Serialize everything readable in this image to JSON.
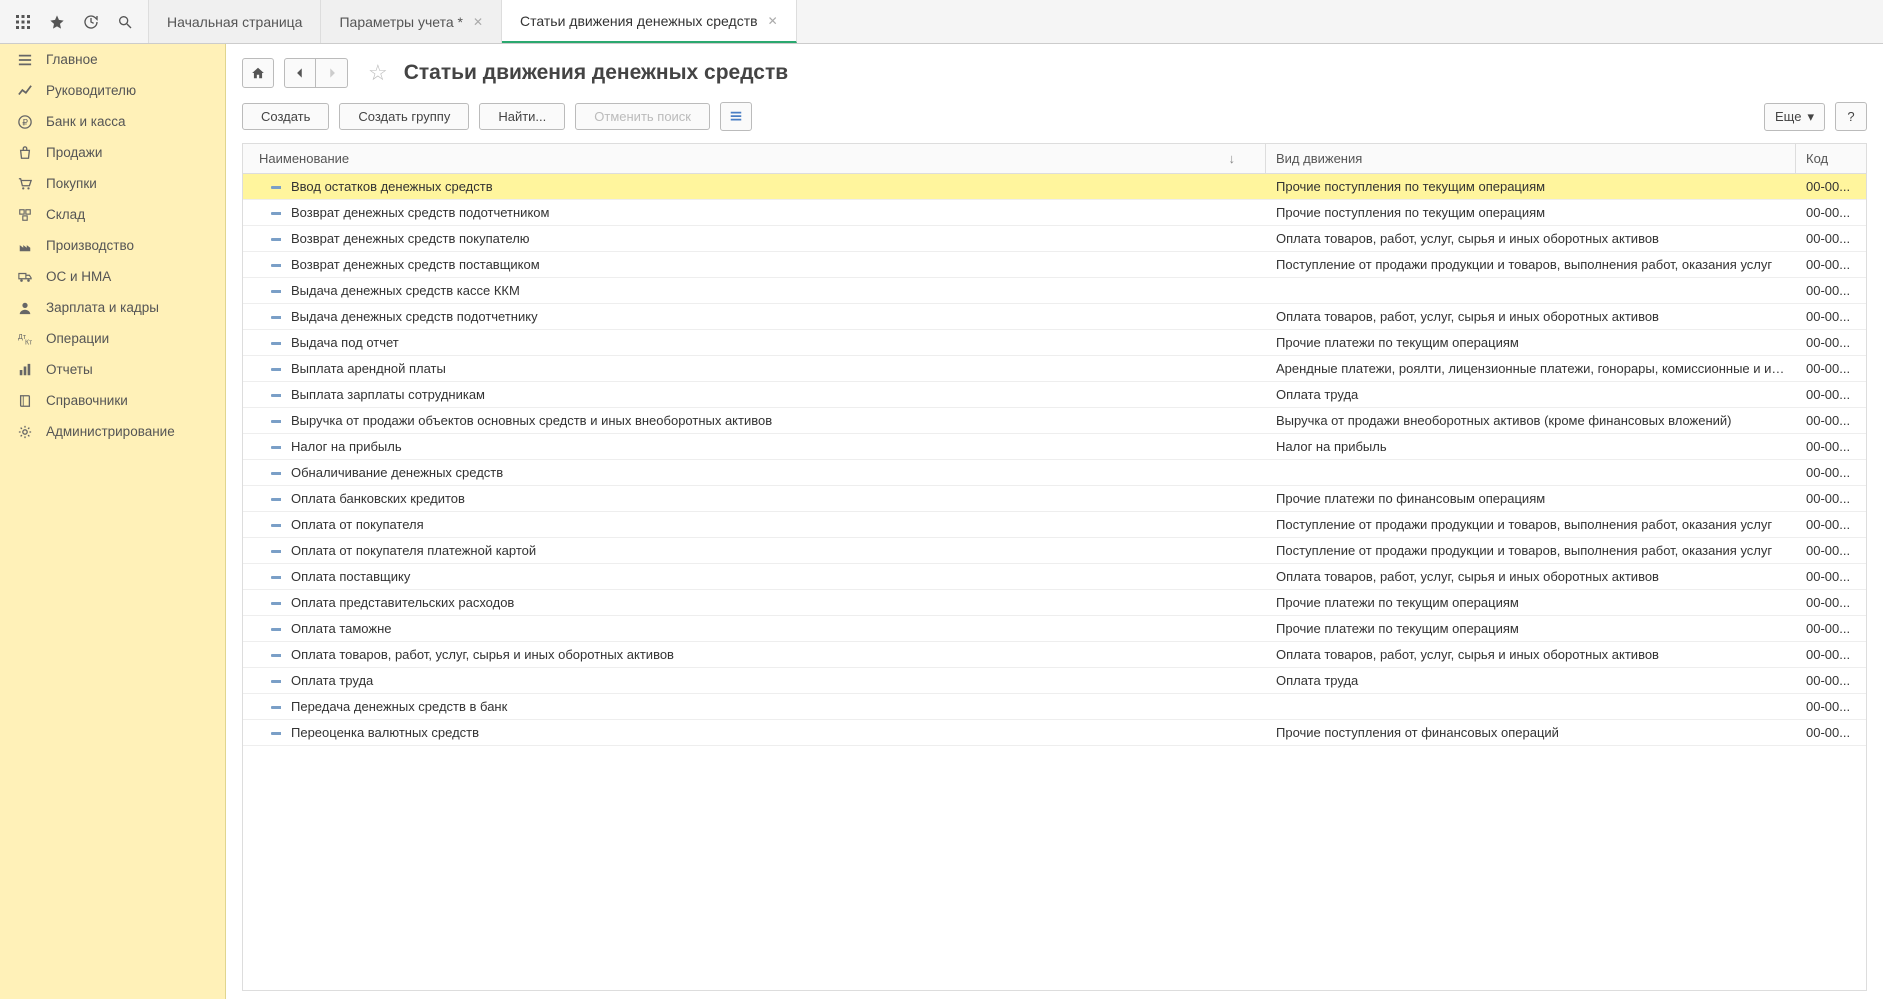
{
  "tabs": {
    "home": "Начальная страница",
    "params": "Параметры учета *",
    "articles": "Статьи движения денежных средств"
  },
  "sidebar": {
    "items": [
      {
        "label": "Главное",
        "icon": "menu"
      },
      {
        "label": "Руководителю",
        "icon": "trend"
      },
      {
        "label": "Банк и касса",
        "icon": "ruble"
      },
      {
        "label": "Продажи",
        "icon": "bag"
      },
      {
        "label": "Покупки",
        "icon": "cart"
      },
      {
        "label": "Склад",
        "icon": "boxes"
      },
      {
        "label": "Производство",
        "icon": "factory"
      },
      {
        "label": "ОС и НМА",
        "icon": "truck"
      },
      {
        "label": "Зарплата и кадры",
        "icon": "person"
      },
      {
        "label": "Операции",
        "icon": "ops"
      },
      {
        "label": "Отчеты",
        "icon": "chart"
      },
      {
        "label": "Справочники",
        "icon": "book"
      },
      {
        "label": "Администрирование",
        "icon": "gear"
      }
    ]
  },
  "page": {
    "title": "Статьи движения денежных средств"
  },
  "toolbar": {
    "create": "Создать",
    "create_group": "Создать группу",
    "find": "Найти...",
    "cancel_search": "Отменить поиск",
    "more": "Еще",
    "help": "?"
  },
  "grid": {
    "columns": {
      "name": "Наименование",
      "type": "Вид движения",
      "code": "Код"
    },
    "rows": [
      {
        "name": "Ввод остатков денежных средств",
        "type": "Прочие поступления по текущим операциям",
        "code": "00-00...",
        "selected": true
      },
      {
        "name": "Возврат денежных средств подотчетником",
        "type": "Прочие поступления по текущим операциям",
        "code": "00-00..."
      },
      {
        "name": "Возврат денежных средств покупателю",
        "type": "Оплата товаров, работ, услуг, сырья и иных оборотных активов",
        "code": "00-00..."
      },
      {
        "name": "Возврат денежных средств поставщиком",
        "type": "Поступление от продажи продукции и товаров, выполнения работ, оказания услуг",
        "code": "00-00..."
      },
      {
        "name": "Выдача денежных средств кассе ККМ",
        "type": "",
        "code": "00-00..."
      },
      {
        "name": "Выдача денежных средств подотчетнику",
        "type": "Оплата товаров, работ, услуг, сырья и иных оборотных активов",
        "code": "00-00..."
      },
      {
        "name": "Выдача под отчет",
        "type": "Прочие платежи по текущим операциям",
        "code": "00-00..."
      },
      {
        "name": "Выплата арендной платы",
        "type": "Арендные платежи, роялти, лицензионные платежи, гонорары, комиссионные и ин...",
        "code": "00-00..."
      },
      {
        "name": "Выплата зарплаты сотрудникам",
        "type": "Оплата труда",
        "code": "00-00..."
      },
      {
        "name": "Выручка от продажи объектов основных средств и иных внеоборотных активов",
        "type": "Выручка от продажи внеоборотных активов (кроме финансовых вложений)",
        "code": "00-00..."
      },
      {
        "name": "Налог на прибыль",
        "type": "Налог на прибыль",
        "code": "00-00..."
      },
      {
        "name": "Обналичивание денежных средств",
        "type": "",
        "code": "00-00..."
      },
      {
        "name": "Оплата банковских кредитов",
        "type": "Прочие платежи по финансовым операциям",
        "code": "00-00..."
      },
      {
        "name": "Оплата от покупателя",
        "type": "Поступление от продажи продукции и товаров, выполнения работ, оказания услуг",
        "code": "00-00..."
      },
      {
        "name": "Оплата от покупателя платежной картой",
        "type": "Поступление от продажи продукции и товаров, выполнения работ, оказания услуг",
        "code": "00-00..."
      },
      {
        "name": "Оплата поставщику",
        "type": "Оплата товаров, работ, услуг, сырья и иных оборотных активов",
        "code": "00-00..."
      },
      {
        "name": "Оплата представительских расходов",
        "type": "Прочие платежи по текущим операциям",
        "code": "00-00..."
      },
      {
        "name": "Оплата таможне",
        "type": "Прочие платежи по текущим операциям",
        "code": "00-00..."
      },
      {
        "name": "Оплата товаров, работ, услуг, сырья и иных оборотных активов",
        "type": "Оплата товаров, работ, услуг, сырья и иных оборотных активов",
        "code": "00-00..."
      },
      {
        "name": "Оплата труда",
        "type": "Оплата труда",
        "code": "00-00..."
      },
      {
        "name": "Передача денежных средств в банк",
        "type": "",
        "code": "00-00..."
      },
      {
        "name": "Переоценка валютных средств",
        "type": "Прочие поступления от финансовых операций",
        "code": "00-00..."
      }
    ]
  }
}
